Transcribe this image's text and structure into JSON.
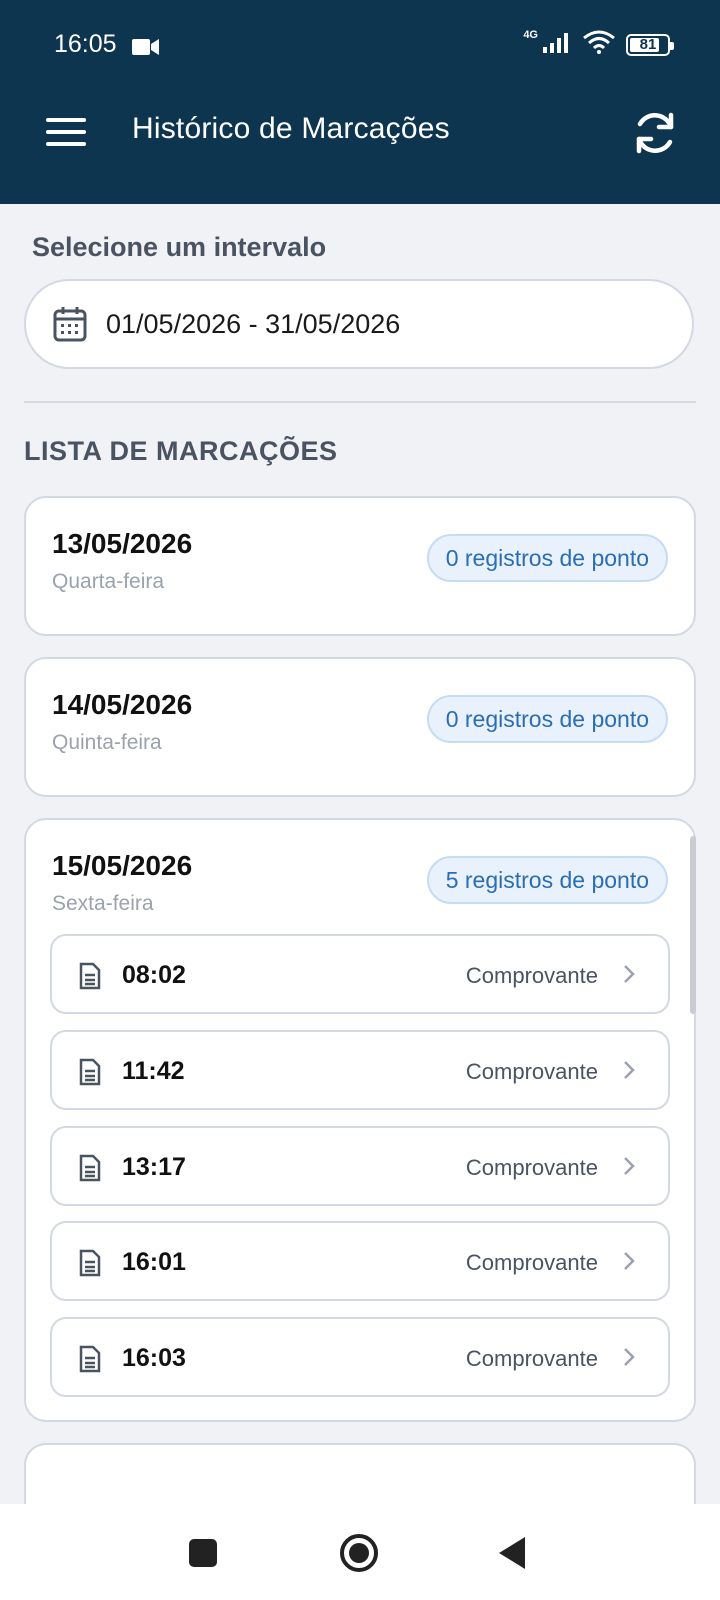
{
  "status_bar": {
    "time": "16:05",
    "network": "4G",
    "battery": "81",
    "battery_level": 0.81
  },
  "app_bar": {
    "title": "Histórico de Marcações"
  },
  "range": {
    "label": "Selecione um intervalo",
    "value": "01/05/2026 - 31/05/2026"
  },
  "list": {
    "title": "LISTA DE MARCAÇÕES",
    "days": [
      {
        "date": "13/05/2026",
        "weekday": "Quarta-feira",
        "count": "0 registros de ponto"
      },
      {
        "date": "14/05/2026",
        "weekday": "Quinta-feira",
        "count": "0 registros de ponto"
      },
      {
        "date": "15/05/2026",
        "weekday": "Sexta-feira",
        "count": "5 registros de ponto",
        "punches": [
          {
            "time": "08:02",
            "link": "Comprovante"
          },
          {
            "time": "11:42",
            "link": "Comprovante"
          },
          {
            "time": "13:17",
            "link": "Comprovante"
          },
          {
            "time": "16:01",
            "link": "Comprovante"
          },
          {
            "time": "16:03",
            "link": "Comprovante"
          }
        ]
      }
    ]
  },
  "colors": {
    "header_bg": "#0e3550",
    "badge_text": "#2a6db4",
    "badge_bg": "#e9f2fc",
    "page_bg": "#f0f2f6"
  },
  "icons": {
    "menu": "hamburger-icon",
    "refresh": "refresh-icon",
    "calendar": "calendar-icon",
    "receipt": "document-icon",
    "chevron": "chevron-right-icon",
    "nav": [
      "recents-square-icon",
      "home-circle-icon",
      "back-triangle-icon"
    ]
  }
}
